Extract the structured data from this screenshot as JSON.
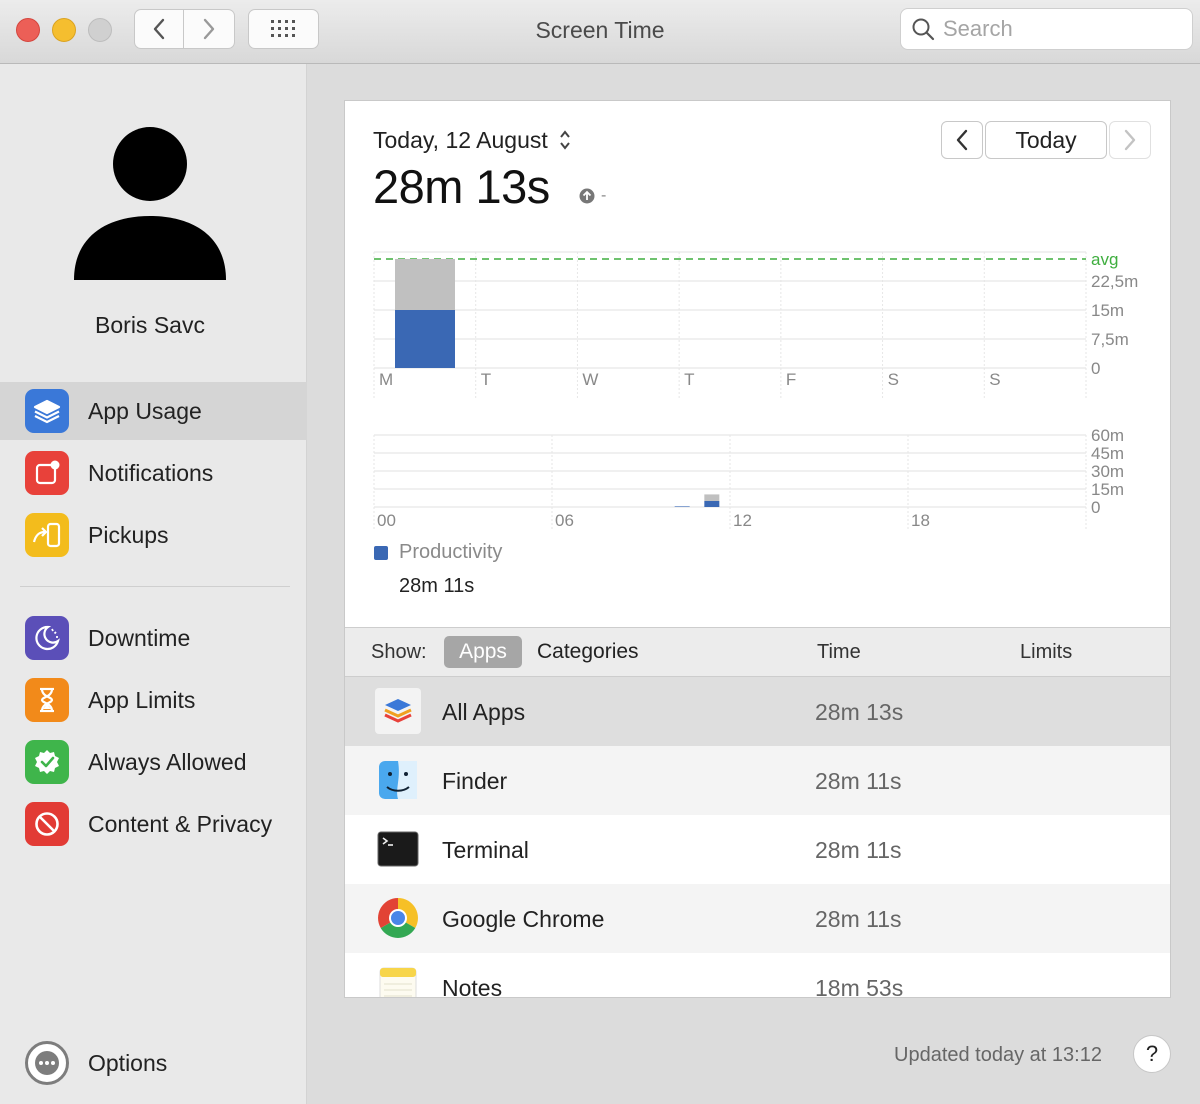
{
  "window": {
    "title": "Screen Time"
  },
  "search": {
    "placeholder": "Search"
  },
  "sidebar": {
    "user_name": "Boris Savc",
    "group1": [
      {
        "label": "App Usage",
        "icon": "app-usage-icon",
        "color": "#3a78d8",
        "active": true
      },
      {
        "label": "Notifications",
        "icon": "notifications-icon",
        "color": "#e8413a"
      },
      {
        "label": "Pickups",
        "icon": "pickups-icon",
        "color": "#f3bc1c"
      }
    ],
    "group2": [
      {
        "label": "Downtime",
        "icon": "downtime-icon",
        "color": "#5b4fb8"
      },
      {
        "label": "App Limits",
        "icon": "app-limits-icon",
        "color": "#f28a1a"
      },
      {
        "label": "Always Allowed",
        "icon": "always-allowed-icon",
        "color": "#3fb54b"
      },
      {
        "label": "Content & Privacy",
        "icon": "content-privacy-icon",
        "color": "#e23b35"
      }
    ],
    "options_label": "Options"
  },
  "header": {
    "date_label": "Today, 12 August",
    "total_time": "28m 13s",
    "delta": "-",
    "today_button": "Today"
  },
  "chart_data": [
    {
      "type": "bar",
      "categories": [
        "M",
        "T",
        "W",
        "T",
        "F",
        "S",
        "S"
      ],
      "series": [
        {
          "color": "#3a68b4",
          "values": [
            15,
            0,
            0,
            0,
            0,
            0,
            0
          ]
        },
        {
          "color": "#c0c0c0",
          "values": [
            13.2,
            0,
            0,
            0,
            0,
            0,
            0
          ]
        }
      ],
      "ytick_labels": [
        "0",
        "7,5m",
        "15m",
        "22,5m"
      ],
      "yticks": [
        0,
        7.5,
        15,
        22.5
      ],
      "ylim": [
        0,
        30
      ],
      "average_label": "avg",
      "average_value": 28.2,
      "average_color": "#3fae3f"
    },
    {
      "type": "bar",
      "categories": [
        "00",
        "06",
        "12",
        "18"
      ],
      "hourly_values_blue": {
        "10": 0.5,
        "11": 5
      },
      "hourly_values_gray": {
        "11": 5.5
      },
      "ytick_labels": [
        "0",
        "15m",
        "30m",
        "45m",
        "60m"
      ],
      "yticks": [
        0,
        15,
        30,
        45,
        60
      ],
      "ylim": [
        0,
        60
      ]
    }
  ],
  "legend": {
    "name": "Productivity",
    "value": "28m 11s",
    "color": "#3a68b4"
  },
  "table": {
    "show_label": "Show:",
    "segment_apps": "Apps",
    "segment_categories": "Categories",
    "col_time": "Time",
    "col_limits": "Limits",
    "rows": [
      {
        "name": "All Apps",
        "time": "28m 13s",
        "icon": "all-apps-icon"
      },
      {
        "name": "Finder",
        "time": "28m 11s",
        "icon": "finder-icon"
      },
      {
        "name": "Terminal",
        "time": "28m 11s",
        "icon": "terminal-icon"
      },
      {
        "name": "Google Chrome",
        "time": "28m 11s",
        "icon": "chrome-icon"
      },
      {
        "name": "Notes",
        "time": "18m 53s",
        "icon": "notes-icon"
      }
    ]
  },
  "footer": {
    "updated": "Updated today at 13:12",
    "help": "?"
  }
}
